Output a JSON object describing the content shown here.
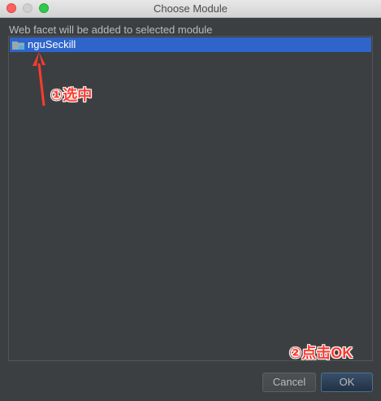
{
  "window": {
    "title": "Choose Module"
  },
  "dialog": {
    "instruction": "Web facet will be added to selected module",
    "modules": [
      {
        "name": "nguSeckill",
        "icon": "module-folder-icon",
        "selected": true
      }
    ]
  },
  "annotations": {
    "step_one": "①选中",
    "step_two": "②点击OK",
    "color": "#ff3b30"
  },
  "buttons": {
    "cancel_label": "Cancel",
    "ok_label": "OK"
  },
  "colors": {
    "selection": "#2f65ca",
    "background": "#3c3f41"
  }
}
